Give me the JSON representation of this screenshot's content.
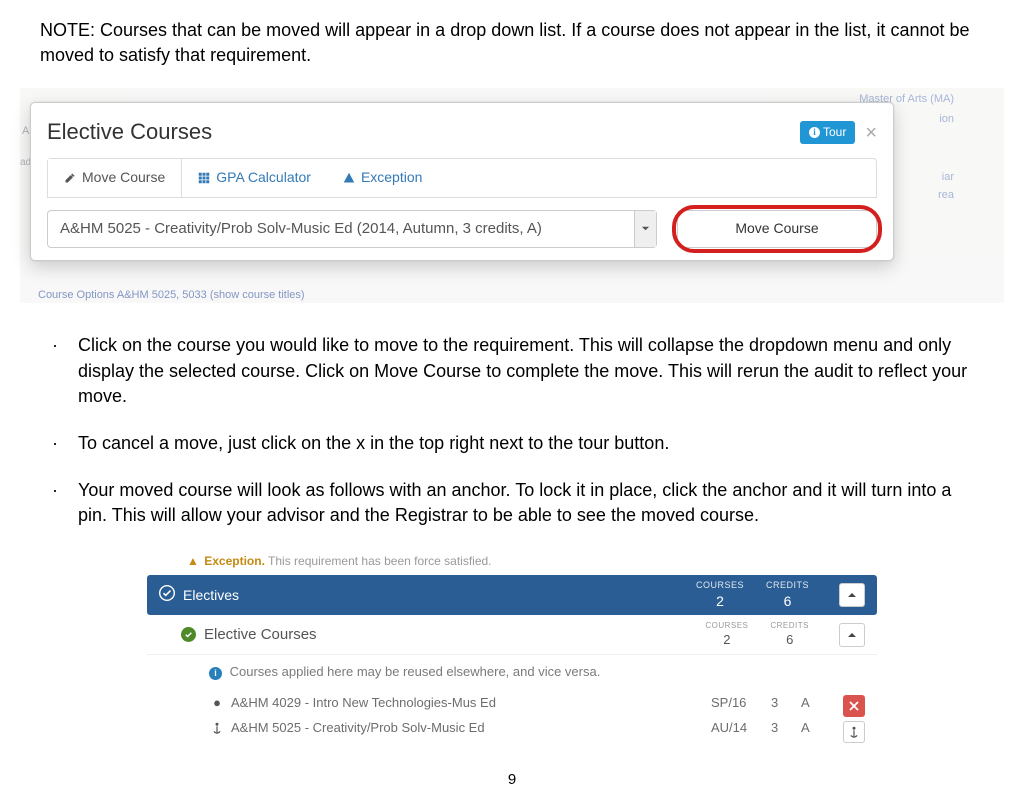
{
  "note": "NOTE: Courses that can be moved will appear in a drop down list. If a course does not appear in the list, it cannot be moved to  satisfy that requirement.",
  "modal": {
    "title": "Elective Courses",
    "tour_label": "Tour",
    "tabs": {
      "move": "Move Course",
      "gpa": "GPA Calculator",
      "exception": "Exception"
    },
    "dropdown_value": "A&HM 5025 - Creativity/Prob Solv-Music Ed (2014, Autumn, 3 credits, A)",
    "move_button": "Move Course",
    "bg_link1": "Master of Arts (MA)",
    "bg_bottom": "Course Options A&HM 5025, 5033  (show course titles)"
  },
  "bullets": [
    "Click on the course you would like to move to the requirement. This will collapse the dropdown menu and only display the selected course. Click on Move Course to complete the move. This will rerun the audit to reflect your move.",
    "To cancel a move, just click on the x in the top right next to the tour button.",
    "Your moved course will look as follows with an anchor. To lock it in place, click the anchor and it will turn into a pin. This will allow your advisor and the Registrar to be able to see the moved course."
  ],
  "audit": {
    "exception_line": "This requirement has been force satisfied.",
    "exception_label": "Exception.",
    "section_title": "Electives",
    "sub_title": "Elective Courses",
    "stats_labels": {
      "courses": "COURSES",
      "credits": "CREDITS"
    },
    "stats": {
      "courses": "2",
      "credits": "6"
    },
    "info": "Courses applied here may be reused elsewhere, and vice versa.",
    "rows": [
      {
        "icon": "dot",
        "name": "A&HM 4029 - Intro New Technologies-Mus Ed",
        "term": "SP/16",
        "cred": "3",
        "grade": "A"
      },
      {
        "icon": "anchor",
        "name": "A&HM 5025 - Creativity/Prob Solv-Music Ed",
        "term": "AU/14",
        "cred": "3",
        "grade": "A"
      }
    ]
  },
  "page_number": "9"
}
